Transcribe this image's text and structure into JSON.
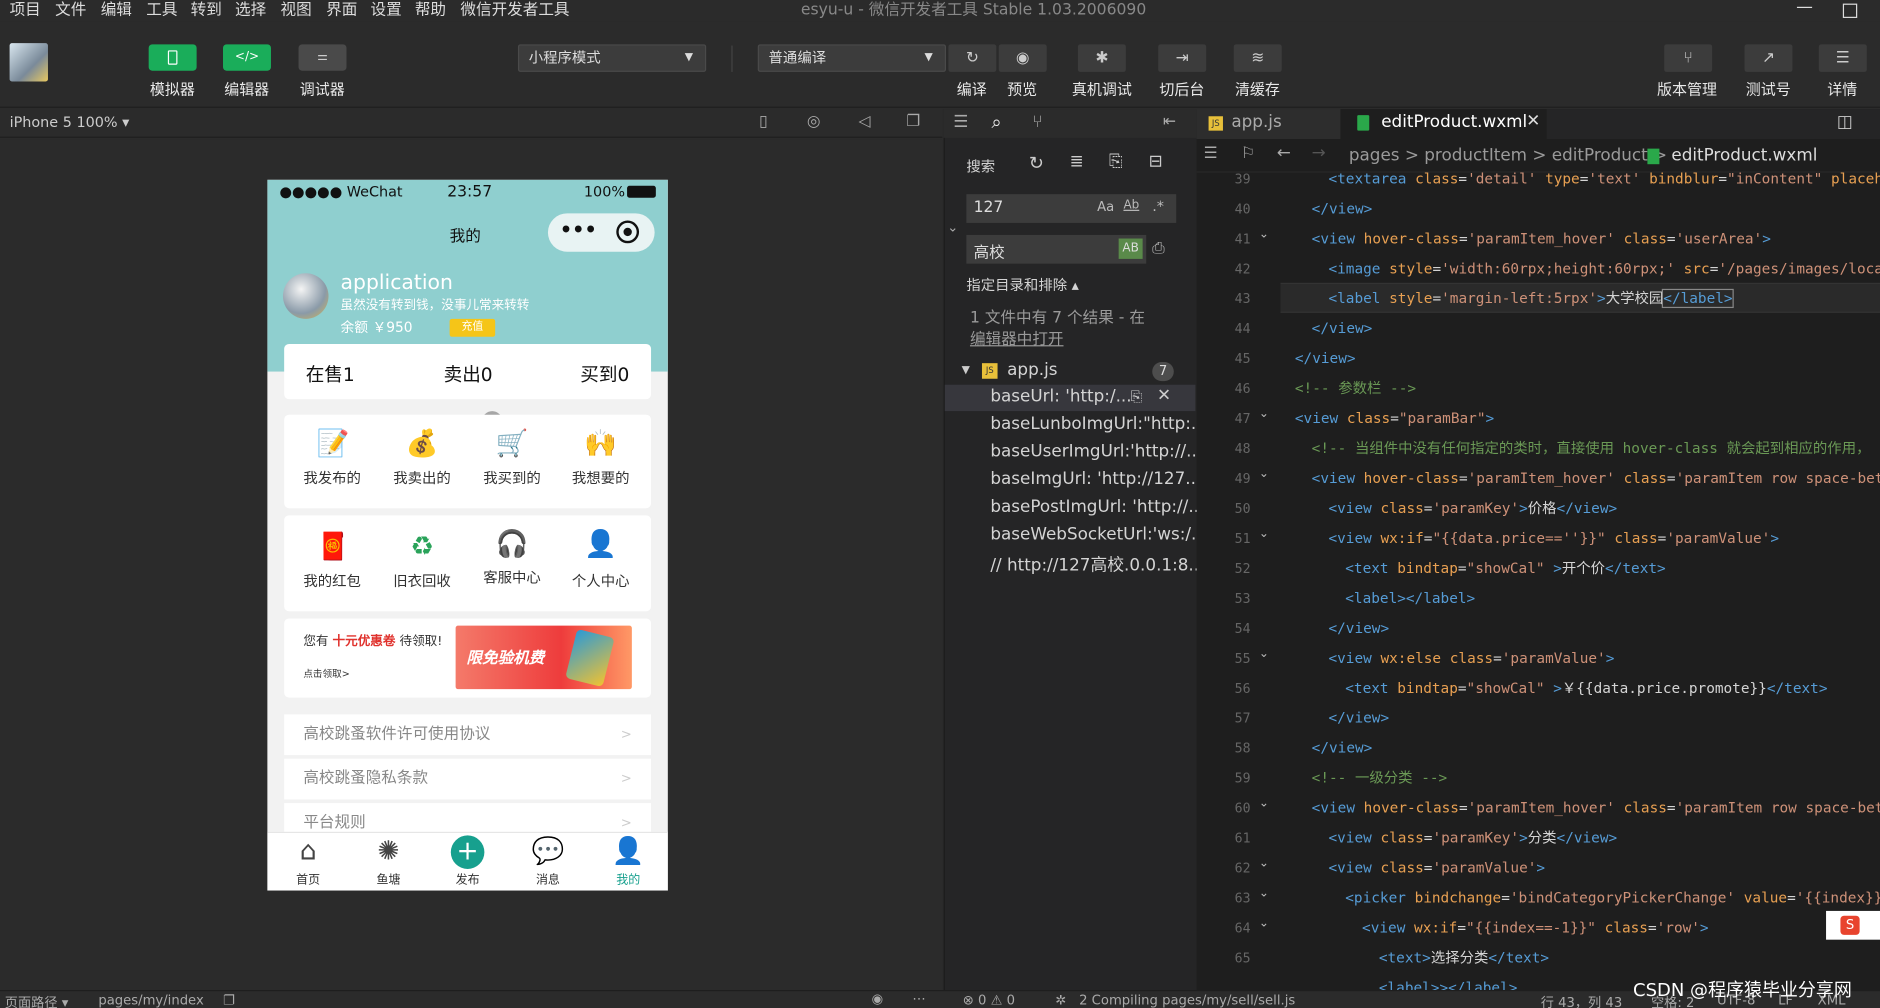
{
  "menu": [
    "项目",
    "文件",
    "编辑",
    "工具",
    "转到",
    "选择",
    "视图",
    "界面",
    "设置",
    "帮助",
    "微信开发者工具"
  ],
  "window_title": "esyu-u - 微信开发者工具 Stable 1.03.2006090",
  "toolbar": {
    "simulator": "模拟器",
    "editor": "编辑器",
    "debugger": "调试器",
    "mode_select": "小程序模式",
    "compile_select": "普通编译",
    "compile": "编译",
    "preview": "预览",
    "remote_debug": "真机调试",
    "background": "切后台",
    "clear_cache": "清缓存",
    "version": "版本管理",
    "test": "测试号",
    "details": "详情"
  },
  "sim": {
    "device": "iPhone 5 100%"
  },
  "phone": {
    "signal": "●●●●● WeChat",
    "time": "23:57",
    "battery": "100%",
    "title": "我的",
    "username": "application",
    "motto": "虽然没有转到钱，没事儿常来转转",
    "balance": "余额 ￥950",
    "recharge": "充值",
    "stats": [
      "在售1",
      "卖出0",
      "买到0"
    ],
    "grid1": [
      {
        "icon": "📝",
        "label": "我发布的"
      },
      {
        "icon": "💰",
        "label": "我卖出的"
      },
      {
        "icon": "🛒",
        "label": "我买到的"
      },
      {
        "icon": "🙌",
        "label": "我想要的"
      }
    ],
    "grid2": [
      {
        "icon": "🧧",
        "label": "我的红包"
      },
      {
        "icon": "♻",
        "label": "旧衣回收"
      },
      {
        "icon": "🎧",
        "label": "客服中心"
      },
      {
        "icon": "👤",
        "label": "个人中心"
      }
    ],
    "coupon_pre": "您有 ",
    "coupon_red": "十元优惠卷",
    "coupon_post": " 待领取!",
    "coupon_sub": "点击领取>",
    "banner_text": "限免验机费",
    "links": [
      "高校跳蚤软件许可使用协议",
      "高校跳蚤隐私条款",
      "平台规则"
    ],
    "tabs": [
      {
        "icon": "⌂",
        "label": "首页"
      },
      {
        "icon": "✺",
        "label": "鱼塘"
      },
      {
        "icon": "+",
        "label": "发布"
      },
      {
        "icon": "💬",
        "label": "消息"
      },
      {
        "icon": "👤",
        "label": "我的"
      }
    ]
  },
  "search": {
    "title": "搜索",
    "query": "127",
    "replace": "高校",
    "filter": "指定目录和排除 ▴",
    "summary1": "1 文件中有 7 个结果 - 在",
    "summary2": "编辑器中打开",
    "file": "app.js",
    "count": "7",
    "results": [
      "baseUrl: 'http:/...",
      "baseLunboImgUrl:\"http:...",
      "baseUserImgUrl:'http://...",
      "baseImgUrl: 'http://127...",
      "basePostImgUrl: 'http://...",
      "baseWebSocketUrl:'ws:/...",
      "// http://127高校.0.0.1:8..."
    ]
  },
  "editor": {
    "tab1": "app.js",
    "tab2": "editProduct.wxml",
    "breadcrumb": "pages > productItem > editProduct > ",
    "breadcrumb_file": "editProduct.wxml",
    "lines": [
      "39",
      "40",
      "41",
      "42",
      "43",
      "44",
      "45",
      "46",
      "47",
      "48",
      "49",
      "50",
      "51",
      "52",
      "53",
      "54",
      "55",
      "56",
      "57",
      "58",
      "59",
      "60",
      "61",
      "62",
      "63",
      "64",
      "65"
    ]
  },
  "status": {
    "path_label": "页面路径 ▾",
    "path": "pages/my/index",
    "errors": "⊗ 0 ⚠ 0",
    "compiling": "2 Compiling pages/my/sell/sell.js",
    "position": "行 43，列 43",
    "spaces": "空格: 2",
    "encoding": "UTF-8",
    "eol": "LF",
    "lang": "XML"
  },
  "watermark": "CSDN @程序猿毕业分享网"
}
